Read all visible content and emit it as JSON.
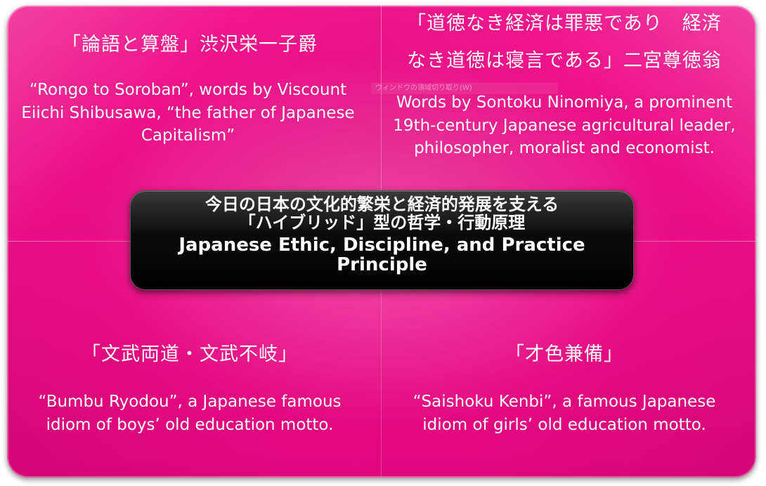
{
  "top_left": {
    "japanese": "「論語と算盤」渋沢栄一子爵",
    "english": "“Rongo to Soroban”, words by Viscount Eiichi Shibusawa, “the father of Japanese Capitalism”"
  },
  "top_right": {
    "japanese_line1": "「道徳なき経済は罪悪であり　経済",
    "japanese_line2": "なき道徳は寝言である」二宮尊徳翁",
    "english": "Words by Sontoku Ninomiya, a prominent 19th-century Japanese agricultural leader, philosopher, moralist and economist."
  },
  "bottom_left": {
    "japanese": "「文武両道・文武不岐」",
    "english": "“Bumbu Ryodou”, a Japanese famous idiom of boys’ old education motto."
  },
  "bottom_right": {
    "japanese": "「才色兼備」",
    "english": "“Saishoku Kenbi”, a famous Japanese idiom of girls’ old education motto."
  },
  "center": {
    "jp_line1": "今日の日本の文化的繁栄と経済的発展を支える",
    "jp_line2": "「ハイブリッド」型の哲学・行動原理",
    "en_line1": "Japanese Ethic, Discipline, and  Practice",
    "en_line2": "Principle"
  },
  "overlay_ghost_text": "ウィンドウの領域切り取り(W)",
  "colors": {
    "magenta": "#e8107f",
    "center_box": "#000000",
    "text": "#ffffff"
  }
}
